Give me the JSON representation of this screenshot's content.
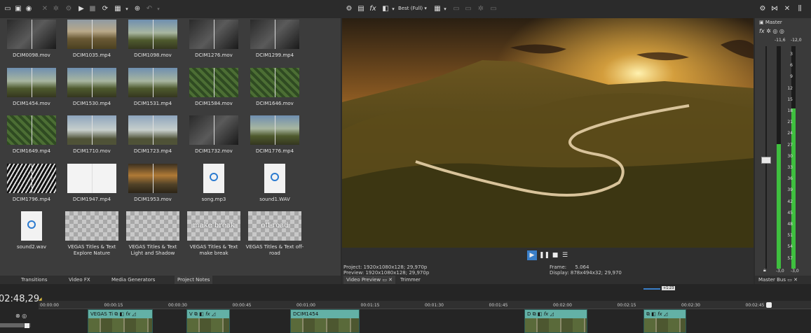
{
  "toolbar": {
    "icons": [
      "import-media-icon",
      "capture-icon",
      "web-icon",
      "remove-icon",
      "auto-preview-icon",
      "play-icon",
      "stop-icon",
      "refresh-icon",
      "views-icon",
      "zoom-icon",
      "undo-icon"
    ]
  },
  "media": {
    "items": [
      {
        "name": "DCIM0098.mov",
        "thumb": "dark"
      },
      {
        "name": "DCIM1035.mp4",
        "thumb": "landscape"
      },
      {
        "name": "DCIM1098.mov",
        "thumb": "moto"
      },
      {
        "name": "DCIM1276.mov",
        "thumb": "dark"
      },
      {
        "name": "DCIM1299.mp4",
        "thumb": "dark"
      },
      {
        "name": "DCIM1454.mov",
        "thumb": "moto"
      },
      {
        "name": "DCIM1530.mp4",
        "thumb": "moto"
      },
      {
        "name": "DCIM1531.mp4",
        "thumb": "moto"
      },
      {
        "name": "DCIM1584.mov",
        "thumb": "green"
      },
      {
        "name": "DCIM1646.mov",
        "thumb": "green"
      },
      {
        "name": "DCIM1649.mp4",
        "thumb": "green"
      },
      {
        "name": "DCIM1710.mov",
        "thumb": "sky"
      },
      {
        "name": "DCIM1723.mp4",
        "thumb": "sky"
      },
      {
        "name": "DCIM1732.mov",
        "thumb": "dark"
      },
      {
        "name": "DCIM1776.mp4",
        "thumb": "moto"
      },
      {
        "name": "DCIM1796.mp4",
        "thumb": "bw"
      },
      {
        "name": "DCIM1947.mp4",
        "thumb": "white"
      },
      {
        "name": "DCIM1953.mov",
        "thumb": "sunset"
      },
      {
        "name": "song.mp3",
        "thumb": "audio"
      },
      {
        "name": "sound1.WAV",
        "thumb": "audio"
      },
      {
        "name": "sound2.wav",
        "thumb": "audio"
      },
      {
        "name": "VEGAS Titles & Text Explore Nature",
        "thumb": "check",
        "overlay": ""
      },
      {
        "name": "VEGAS Titles & Text Light and Shadow",
        "thumb": "check",
        "overlay": ""
      },
      {
        "name": "VEGAS Titles & Text make break",
        "thumb": "check",
        "overlay": "make break"
      },
      {
        "name": "VEGAS Titles & Text off-road",
        "thumb": "check",
        "overlay": "off-road"
      }
    ],
    "tabs": [
      "Transitions",
      "Video FX",
      "Media Generators",
      "Project Notes"
    ]
  },
  "preview": {
    "quality": "Best (Full)",
    "project_label": "Project:",
    "project_value": "1920x1080x128; 29,970p",
    "preview_label": "Preview:",
    "preview_value": "1920x1080x128; 29,970p",
    "frame_label": "Frame:",
    "frame_value": "5.064",
    "display_label": "Display:",
    "display_value": "878x494x32; 29,970",
    "tabs": [
      "Video Preview",
      "Trimmer"
    ]
  },
  "master": {
    "title": "Master",
    "peak_left": "-11,6",
    "peak_right": "-12,0",
    "scale": [
      "3",
      "6",
      "9",
      "12",
      "15",
      "18",
      "21",
      "24",
      "27",
      "30",
      "33",
      "36",
      "39",
      "42",
      "45",
      "48",
      "51",
      "54",
      "57"
    ],
    "bottom_left": "-3,0",
    "bottom_right": "-3,0",
    "tab": "Master Bus",
    "colors": {
      "meter": "#3fbf3f"
    }
  },
  "timeline": {
    "timecode": "02:48,29",
    "ruler": [
      "00:00:00",
      "00:00:15",
      "00:00:30",
      "00:00:45",
      "00:01:00",
      "00:01:15",
      "00:01:30",
      "00:01:45",
      "00:02:00",
      "00:02:15",
      "00:02:30",
      "00:02:45"
    ],
    "clips": [
      "VEGAS Ti",
      "V",
      "DCIM1454",
      "D",
      ""
    ],
    "marker": "+1:23"
  }
}
